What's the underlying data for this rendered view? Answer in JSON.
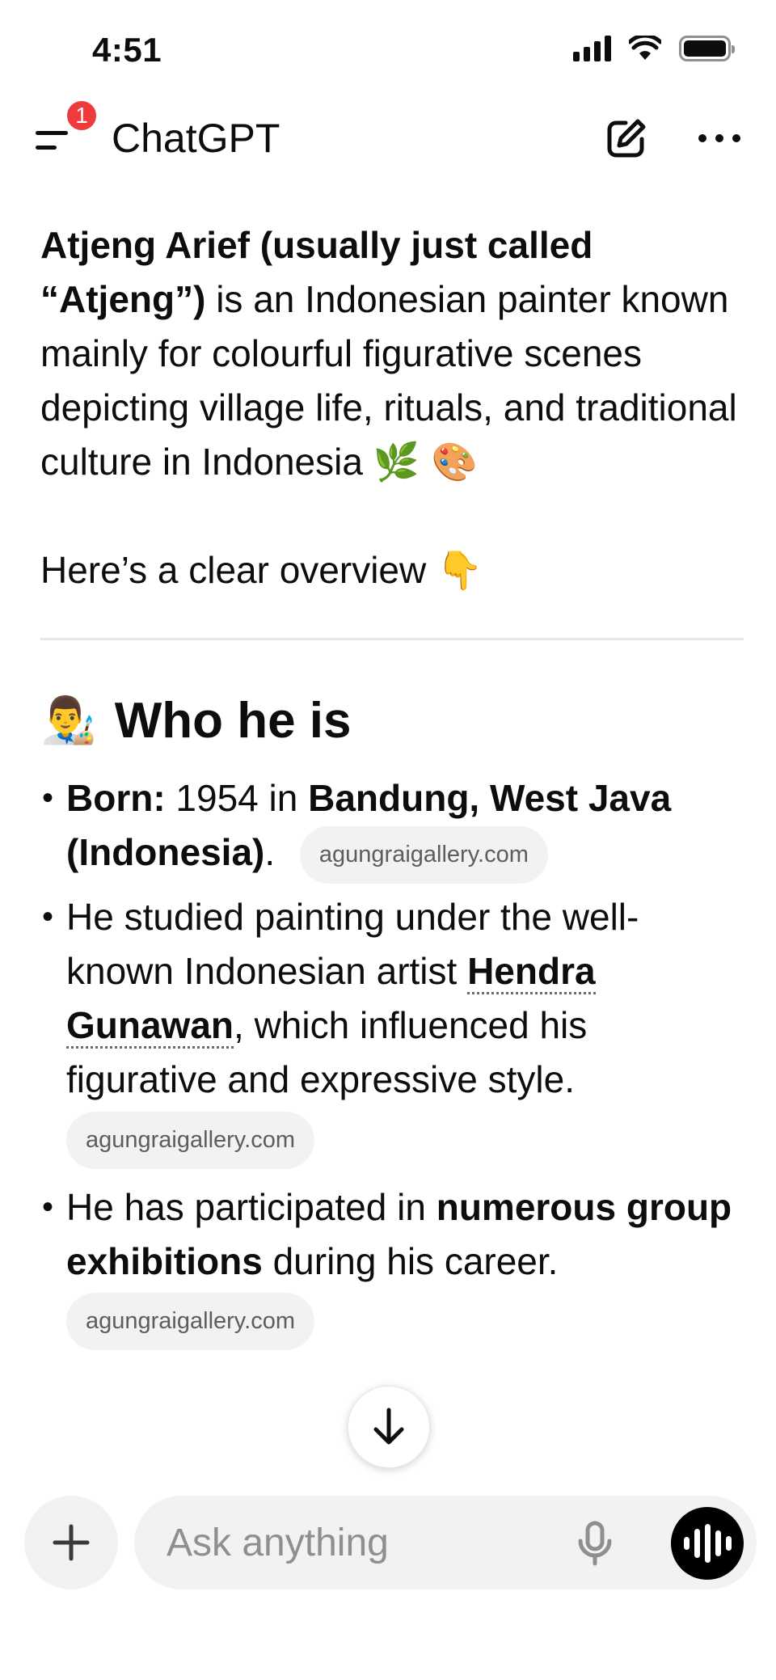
{
  "status_bar": {
    "time": "4:51"
  },
  "header": {
    "title": "ChatGPT",
    "notification_count": "1"
  },
  "message": {
    "intro_bold": "Atjeng Arief (usually just called “Atjeng”)",
    "intro_rest": " is an Indonesian painter known mainly for colourful figurative scenes depicting village life, rituals, and traditional culture in Indonesia ",
    "intro_emojis": "🌿 🎨",
    "overview": "Here’s a clear overview ",
    "overview_emoji": "👇",
    "section_emoji": "👨‍🎨",
    "section_title": "Who he is",
    "bullets": [
      {
        "born_label": "Born:",
        "born_year": " 1954 in ",
        "born_place": "Bandung, West Java (Indonesia)",
        "after": ".",
        "source": "agungraigallery.com"
      },
      {
        "text_before": "He studied painting under the well-known Indonesian artist ",
        "link": "Hendra Gunawan",
        "text_after": ", which influenced his figurative and expressive style.",
        "source": "agungraigallery.com"
      },
      {
        "text_before": "He has participated in ",
        "bold": "numerous group exhibitions",
        "text_after": " during his career.",
        "source": "agungraigallery.com"
      }
    ]
  },
  "composer": {
    "placeholder": "Ask anything"
  },
  "icons": {
    "menu": "menu-icon",
    "compose": "compose-icon",
    "more": "more-icon",
    "scroll_down": "arrow-down-icon",
    "plus": "plus-icon",
    "mic": "mic-icon",
    "voice": "voice-mode-icon"
  },
  "colors": {
    "badge": "#ef3b3b",
    "chip_bg": "#f2f2f2",
    "voice_btn": "#000000"
  }
}
